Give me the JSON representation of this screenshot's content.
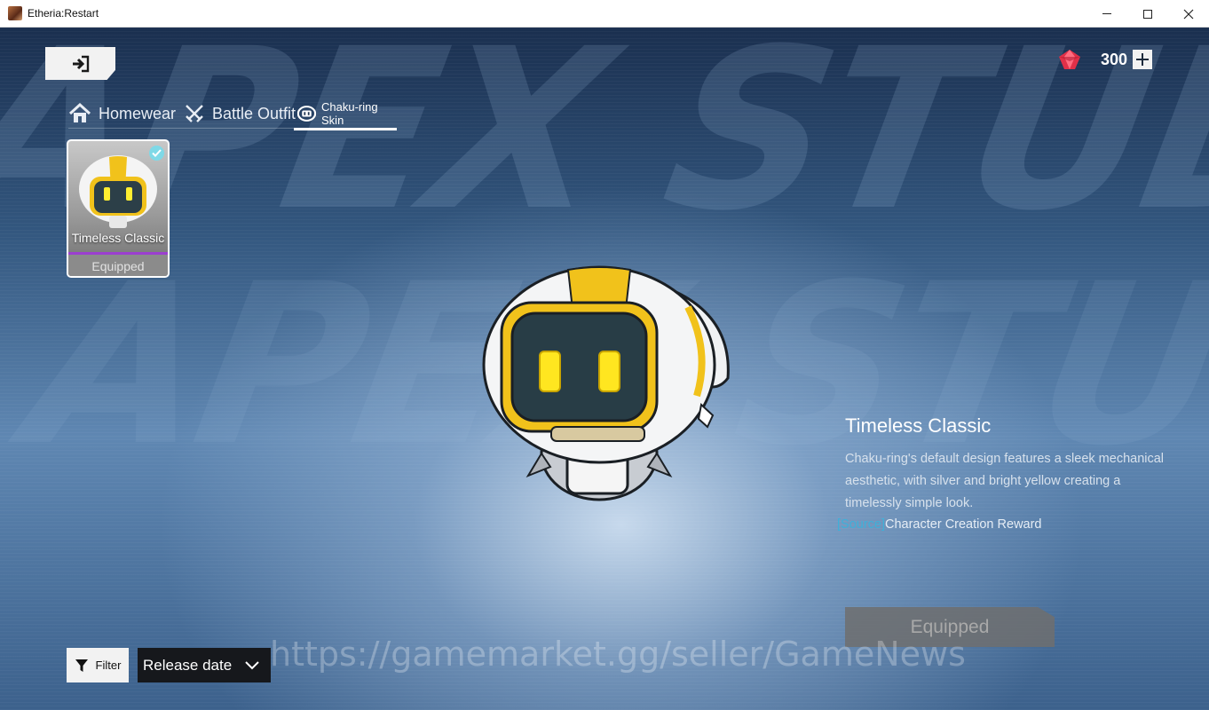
{
  "window": {
    "title": "Etheria:Restart"
  },
  "background": {
    "text_line1": "APEX STUDIE",
    "text_line2": "APEX STUDIES"
  },
  "currency": {
    "icon": "red-gem-icon",
    "amount": "300",
    "add_icon": "plus-icon"
  },
  "tabs": [
    {
      "label": "Homewear",
      "icon": "house-icon",
      "active": false
    },
    {
      "label": "Battle Outfit",
      "icon": "crossed-swords-icon",
      "active": false
    },
    {
      "label": "Chaku-ring Skin",
      "icon": "robot-head-icon",
      "active": true
    }
  ],
  "skins": [
    {
      "name": "Timeless Classic",
      "status": "Equipped",
      "selected": true
    }
  ],
  "detail": {
    "title": "Timeless Classic",
    "description": "Chaku-ring's default design features a sleek mechanical aesthetic, with silver and bright yellow creating a timelessly simple look.",
    "source_tag": "[Source]",
    "source_text": "Character Creation Reward",
    "button_label": "Equipped"
  },
  "filter": {
    "label": "Filter",
    "sort_value": "Release date"
  },
  "watermark": "https://gamemarket.gg/seller/GameNews",
  "colors": {
    "accent_purple": "#9b3fd0",
    "source_cyan": "#3fb0d9",
    "robot_yellow": "#f1c21b"
  }
}
